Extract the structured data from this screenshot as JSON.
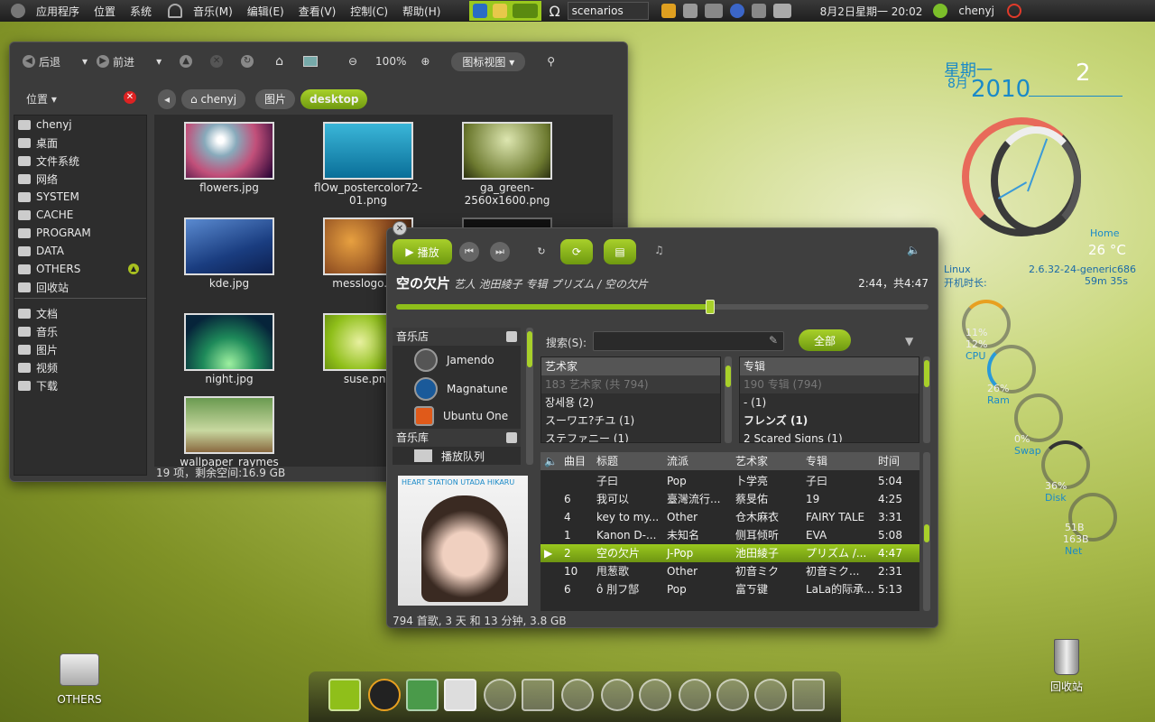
{
  "top_panel": {
    "menus": [
      "应用程序",
      "位置",
      "系统"
    ],
    "music_menus": [
      "音乐(M)",
      "编辑(E)",
      "查看(V)",
      "控制(C)",
      "帮助(H)"
    ],
    "search_value": "scenarios",
    "clock": "8月2日星期一 20:02",
    "user": "chenyj"
  },
  "file_manager": {
    "toolbar": {
      "back": "后退",
      "forward": "前进",
      "zoom": "100%",
      "view": "图标视图"
    },
    "places_label": "位置",
    "breadcrumbs": [
      "chenyj",
      "图片",
      "desktop"
    ],
    "sidebar": [
      "chenyj",
      "桌面",
      "文件系统",
      "网络",
      "SYSTEM",
      "CACHE",
      "PROGRAM",
      "DATA",
      "OTHERS",
      "回收站",
      "文档",
      "音乐",
      "图片",
      "视频",
      "下载"
    ],
    "files": [
      "flowers.jpg",
      "flOw_postercolor72-01.png",
      "ga_green-2560x1600.png",
      "kde.jpg",
      "messlogo.jpg",
      "night.jpg",
      "suse.png",
      "wallpaper_raymes"
    ],
    "status": "19 项，剩余空间:16.9 GB"
  },
  "music_player": {
    "play_label": "播放",
    "song_title": "空の欠片",
    "song_meta": "艺人 池田綾子 专辑 プリズム / 空の欠片",
    "time": "2:44，共4:47",
    "progress": 0.59,
    "store_header": "音乐店",
    "stores": [
      "Jamendo",
      "Magnatune",
      "Ubuntu One"
    ],
    "library_header": "音乐库",
    "library_item": "播放队列",
    "search_label": "搜索(S):",
    "all_button": "全部",
    "artist_header": "艺术家",
    "artists": [
      "183 艺术家 (共 794)",
      "장세용 (2)",
      "スーワエ?チユ (1)",
      "ステファニー (1)"
    ],
    "album_header": "专辑",
    "albums": [
      "190 专辑 (794)",
      "- (1)",
      "フレンズ (1)",
      "2 Scared Signs (1)"
    ],
    "track_headers": [
      "",
      "曲目",
      "标题",
      "流派",
      "艺术家",
      "专辑",
      "时间"
    ],
    "tracks": [
      {
        "no": "",
        "title": "子曰",
        "genre": "Pop",
        "artist": "卜学亮",
        "album": "子曰",
        "time": "5:04"
      },
      {
        "no": "6",
        "title": "我可以",
        "genre": "臺灣流行...",
        "artist": "蔡旻佑",
        "album": "19",
        "time": "4:25"
      },
      {
        "no": "4",
        "title": "key to my...",
        "genre": "Other",
        "artist": "仓木麻衣",
        "album": "FAIRY TALE",
        "time": "3:31"
      },
      {
        "no": "1",
        "title": "Kanon D-...",
        "genre": "未知名",
        "artist": "侧耳倾听",
        "album": "EVA",
        "time": "5:08"
      },
      {
        "no": "2",
        "title": "空の欠片",
        "genre": "J-Pop",
        "artist": "池田綾子",
        "album": "プリズム /...",
        "time": "4:47"
      },
      {
        "no": "10",
        "title": "甩葱歌",
        "genre": "Other",
        "artist": "初音ミク",
        "album": "初音ミク...",
        "time": "2:31"
      },
      {
        "no": "6",
        "title": "ô 刖フ郜",
        "genre": "Pop",
        "artist": "富ㄎ键",
        "album": "LaLa的际承...",
        "time": "5:13"
      }
    ],
    "cover_text": "HEART STATION UTADA HIKARU",
    "status": "794 首歌, 3 天 和 13 分钟, 3.8 GB"
  },
  "widgets": {
    "weekday": "星期一",
    "month": "8月",
    "year": "2010",
    "day": "2",
    "home": "Home",
    "temp": "26 °C",
    "os": "Linux",
    "kernel": "2.6.32-24-generic686",
    "uptime_label": "开机时长:",
    "uptime": "59m 35s",
    "cpu1": "11%",
    "cpu2": "12%",
    "cpu": "CPU",
    "ram_pct": "26%",
    "ram": "Ram",
    "swap_pct": "0%",
    "swap": "Swap",
    "disk_pct": "36%",
    "disk": "Disk",
    "net_up": "51B",
    "net_down": "163B",
    "net": "Net"
  },
  "desktop": {
    "drive_label": "OTHERS",
    "trash_label": "回收站"
  },
  "colors": {
    "accent": "#8fbf1a",
    "panel": "#262626"
  }
}
